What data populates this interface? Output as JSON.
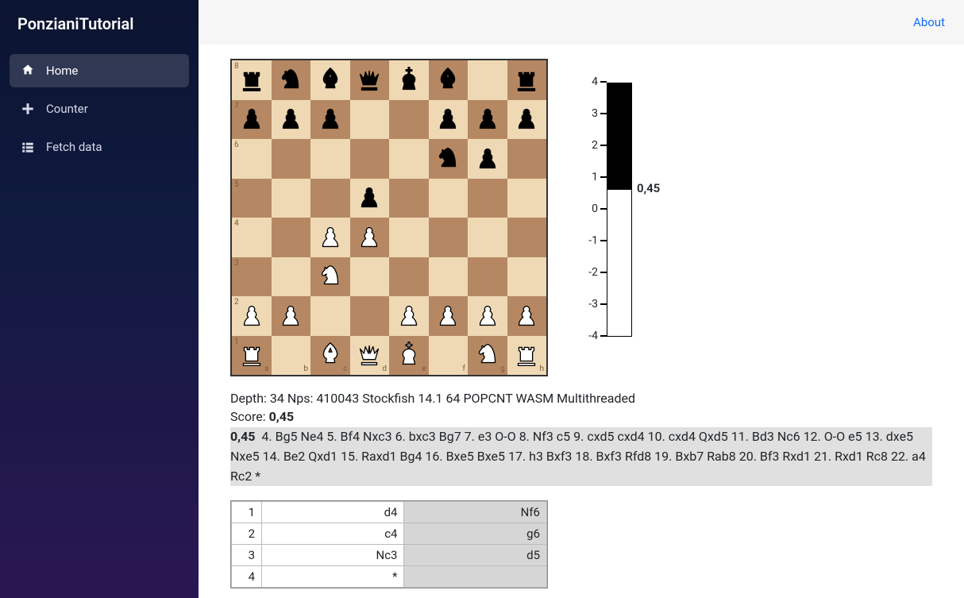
{
  "brand": "PonzianiTutorial",
  "topbar": {
    "about": "About"
  },
  "nav": [
    {
      "icon": "home-icon",
      "label": "Home",
      "active": true
    },
    {
      "icon": "plus-icon",
      "label": "Counter",
      "active": false
    },
    {
      "icon": "list-icon",
      "label": "Fetch data",
      "active": false
    }
  ],
  "board": {
    "ranks": [
      "8",
      "7",
      "6",
      "5",
      "4",
      "3",
      "2",
      "1"
    ],
    "files": [
      "a",
      "b",
      "c",
      "d",
      "e",
      "f",
      "g",
      "h"
    ],
    "position": [
      [
        "r",
        "n",
        "b",
        "q",
        "k",
        "b",
        "",
        "r"
      ],
      [
        "p",
        "p",
        "p",
        "",
        "",
        "p",
        "p",
        "p"
      ],
      [
        "",
        "",
        "",
        "",
        "",
        "n",
        "p",
        ""
      ],
      [
        "",
        "",
        "",
        "p",
        "",
        "",
        "",
        ""
      ],
      [
        "",
        "",
        "P",
        "P",
        "",
        "",
        "",
        ""
      ],
      [
        "",
        "",
        "N",
        "",
        "",
        "",
        "",
        ""
      ],
      [
        "P",
        "P",
        "",
        "",
        "P",
        "P",
        "P",
        "P"
      ],
      [
        "R",
        "",
        "B",
        "Q",
        "K",
        "",
        "N",
        "R"
      ]
    ]
  },
  "eval": {
    "ticks": [
      "4",
      "3",
      "2",
      "1",
      "0",
      "-1",
      "-2",
      "-3",
      "-4"
    ],
    "value_label": "0,45",
    "black_pct": 42
  },
  "engine": {
    "status": "Depth: 34 Nps: 410043 Stockfish 14.1 64 POPCNT WASM Multithreaded",
    "score_prefix": "Score: ",
    "score_value": "0,45",
    "pv_score": "0,45",
    "pv_moves": "4. Bg5 Ne4 5. Bf4 Nxc3 6. bxc3 Bg7 7. e3 O-O 8. Nf3 c5 9. cxd5 cxd4 10. cxd4 Qxd5 11. Bd3 Nc6 12. O-O e5 13. dxe5 Nxe5 14. Be2 Qxd1 15. Raxd1 Bg4 16. Bxe5 Bxe5 17. h3 Bxf3 18. Bxf3 Rfd8 19. Bxb7 Rab8 20. Bf3 Rxd1 21. Rxd1 Rc8 22. a4 Rc2 *"
  },
  "moves": [
    {
      "n": "1",
      "w": "d4",
      "b": "Nf6"
    },
    {
      "n": "2",
      "w": "c4",
      "b": "g6"
    },
    {
      "n": "3",
      "w": "Nc3",
      "b": "d5"
    },
    {
      "n": "4",
      "w": "*",
      "b": ""
    }
  ]
}
